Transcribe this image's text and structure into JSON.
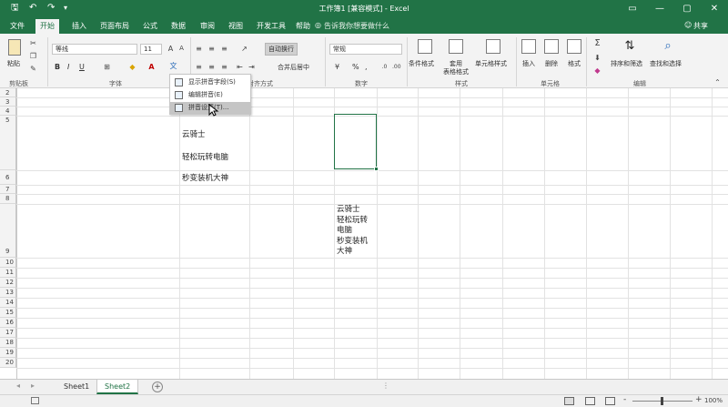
{
  "title_bar": {
    "title": "工作簿1  [兼容模式]  -  Excel",
    "save_icon": "save-icon",
    "undo_icon": "undo-icon",
    "redo_icon": "redo-icon",
    "customize_icon": "customize-qat-icon",
    "ribbon_display_glyph": "▭",
    "minimize_glyph": "—",
    "restore_glyph": "▢",
    "close_glyph": "✕"
  },
  "tabs": [
    "文件",
    "开始",
    "插入",
    "页面布局",
    "公式",
    "数据",
    "审阅",
    "视图",
    "开发工具",
    "帮助"
  ],
  "active_tab": "开始",
  "tell_me": "告诉我你想要做什么",
  "share": "共享",
  "ribbon": {
    "clipboard": {
      "paste": "粘贴",
      "label": "剪贴板"
    },
    "font": {
      "name": "等线",
      "size": "11",
      "bold": "B",
      "italic": "I",
      "underline": "U",
      "label": "字体"
    },
    "alignment": {
      "wrap_text": "自动换行",
      "merge_center": "合并后居中",
      "label": "对齐方式"
    },
    "number": {
      "format": "常规",
      "percent": "%",
      "comma": ",",
      "label": "数字"
    },
    "styles": {
      "conditional": "条件格式",
      "table_format_line1": "套用",
      "table_format_line2": "表格格式",
      "cell_styles": "单元格样式",
      "label": "样式"
    },
    "cells": {
      "insert": "插入",
      "delete": "删除",
      "format": "格式",
      "label": "单元格"
    },
    "editing": {
      "sort_filter": "排序和筛选",
      "find_select": "查找和选择",
      "label": "编辑"
    }
  },
  "phonetic_menu": {
    "items": [
      "显示拼音字段(S)",
      "编辑拼音(E)",
      "拼音设置(T)..."
    ],
    "highlighted_index": 2
  },
  "rows": [
    "2",
    "3",
    "4",
    "5",
    "6",
    "7",
    "8",
    "9",
    "10",
    "11",
    "12",
    "13",
    "14",
    "15",
    "16",
    "17",
    "18",
    "19",
    "20"
  ],
  "cells": {
    "b5_line1": "云骑士",
    "b5_line2": "轻松玩转电脑",
    "b5_line3": "秒变装机大神",
    "e9_lines": [
      "云骑士",
      "轻松玩转",
      "电脑",
      "秒变装机",
      "大神"
    ]
  },
  "sheets": [
    "Sheet1",
    "Sheet2"
  ],
  "active_sheet": "Sheet2",
  "add_sheet": "+",
  "status": {
    "zoom": "100%",
    "zoom_minus": "-",
    "zoom_plus": "+"
  },
  "colors": {
    "accent": "#217346",
    "menu_highlight": "#c5c5c5"
  }
}
